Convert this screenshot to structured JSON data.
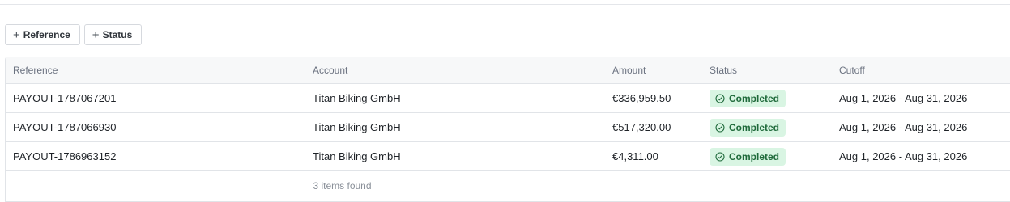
{
  "filters": {
    "reference_label": "Reference",
    "status_label": "Status"
  },
  "table": {
    "columns": {
      "reference": "Reference",
      "account": "Account",
      "amount": "Amount",
      "status": "Status",
      "cutoff": "Cutoff"
    },
    "rows": [
      {
        "reference": "PAYOUT-1787067201",
        "account": "Titan Biking GmbH",
        "amount": "€336,959.50",
        "status": "Completed",
        "cutoff": "Aug 1, 2026 - Aug 31, 2026"
      },
      {
        "reference": "PAYOUT-1787066930",
        "account": "Titan Biking GmbH",
        "amount": "€517,320.00",
        "status": "Completed",
        "cutoff": "Aug 1, 2026 - Aug 31, 2026"
      },
      {
        "reference": "PAYOUT-1786963152",
        "account": "Titan Biking GmbH",
        "amount": "€4,311.00",
        "status": "Completed",
        "cutoff": "Aug 1, 2026 - Aug 31, 2026"
      }
    ],
    "footer": "3 items found"
  },
  "icons": {
    "filter_add": "plus-icon",
    "status": "check-circle-icon"
  },
  "colors": {
    "status_badge_bg": "#d9f5e3",
    "status_badge_text": "#1f6a3b"
  }
}
